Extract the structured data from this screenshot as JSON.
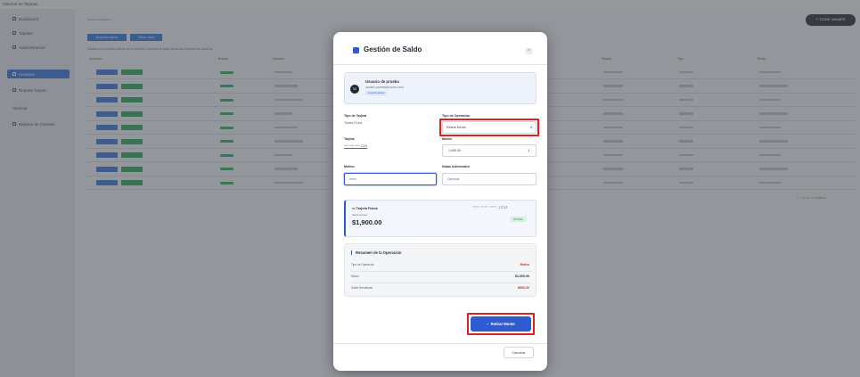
{
  "app": {
    "brand": "Sistema de Tarjetas",
    "new_user_label": "+ Crear usuario",
    "search_placeholder": "Buscar usuarios...",
    "filter_buttons": [
      "Exportar datos",
      "Filtrar lista"
    ],
    "hint": "Usuarios con tarjetas activas en el sistema. Gestione el saldo desde las acciones de cada fila.",
    "sidebar": [
      "Dashboard",
      "Tarjetas",
      "Administración",
      "Usuarios",
      "Reporte Tarjeta",
      "Historial",
      "Balance de Cuentas"
    ],
    "columns": [
      "Acciones",
      "Estado",
      "Nombre",
      "Tarjeta",
      "Tipo",
      "Email"
    ],
    "row_values": [
      "Usuario",
      "Activo",
      "Cliente"
    ],
    "pagination": "1 - 10 de 24 registros"
  },
  "modal": {
    "title": "Gestión de Saldo",
    "close": "×",
    "user": {
      "initial": "U",
      "name": "Usuario de prueba",
      "email": "usuario.prueba@correo.com",
      "badge": "Cuenta activa"
    },
    "fields": {
      "card_type_label": "Tipo de Tarjeta",
      "card_type_value": "Tarjeta Física",
      "operation_label": "Tipo de Operación",
      "operation_value": "Retirar Monto",
      "card_label": "Tarjeta",
      "card_value": "**** **** **** 1234",
      "amount_label": "Monto",
      "amount_value": "1,000.00",
      "reason_label": "Motivo",
      "reason_value": "retiro",
      "notes_label": "Notas Adicionales",
      "notes_value": "Opcional"
    },
    "card": {
      "title": "Tarjeta Física",
      "mask": "**** **** **** 1234",
      "balance_label": "Saldo Actual",
      "balance": "$1,900.00",
      "status": "ACTIVA"
    },
    "summary": {
      "title": "Resumen de la Operación",
      "rows": [
        {
          "label": "Tipo de Operación",
          "value": "Retiro",
          "color": "#e02020"
        },
        {
          "label": "Monto",
          "value": "$1,000.00",
          "color": "#1e2530"
        },
        {
          "label": "Saldo Resultante",
          "value": "$900.00",
          "color": "#e02020"
        }
      ]
    },
    "submit_label": "Retirar Monto",
    "cancel_label": "Cancelar"
  },
  "colors": {
    "accent": "#2e5bd0",
    "highlight": "#e02020",
    "success": "#23a353"
  },
  "icons": {
    "title": "wallet-icon",
    "close": "close-icon",
    "select": "chevron-down-icon",
    "stepper": "stepper-icon",
    "card": "credit-card-icon",
    "submit": "minus-icon"
  }
}
